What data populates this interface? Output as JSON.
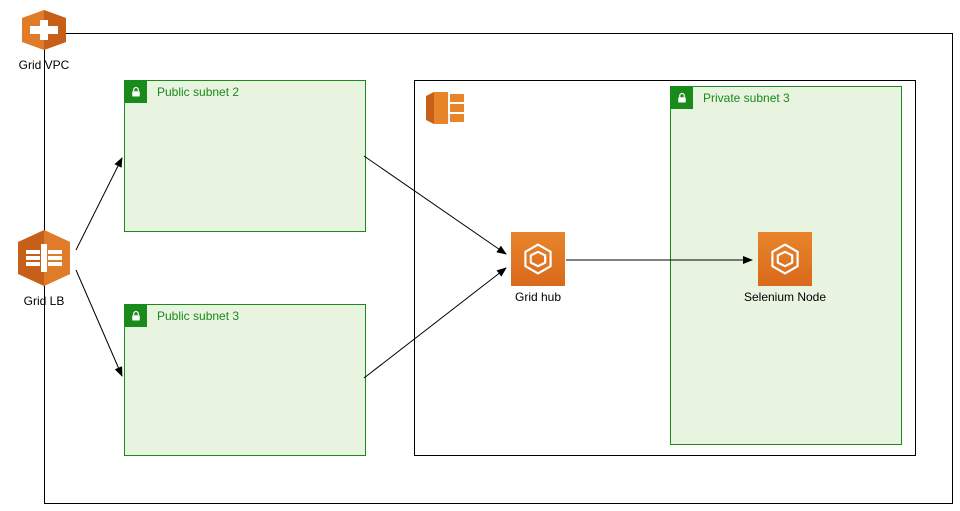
{
  "vpc": {
    "label": "Grid VPC"
  },
  "lb": {
    "label": "Grid LB"
  },
  "subnets": {
    "public2": {
      "label": "Public subnet 2"
    },
    "public3": {
      "label": "Public subnet 3"
    },
    "private3": {
      "label": "Private subnet 3"
    }
  },
  "nodes": {
    "grid_hub": {
      "label": "Grid hub"
    },
    "selenium_node": {
      "label": "Selenium Node"
    }
  },
  "icons": {
    "vpc_icon": "vpc-icon",
    "lb_icon": "load-balancer-icon",
    "ecs_icon": "ecs-cluster-icon",
    "ecs_service_icon": "ecs-service-icon",
    "lock_icon": "lock-icon"
  },
  "chart_data": {
    "type": "diagram",
    "title": "",
    "nodes": [
      {
        "id": "grid_vpc",
        "label": "Grid VPC",
        "type": "vpc-container"
      },
      {
        "id": "grid_lb",
        "label": "Grid LB",
        "type": "load-balancer"
      },
      {
        "id": "pub2",
        "label": "Public subnet 2",
        "type": "public-subnet",
        "parent": "grid_vpc"
      },
      {
        "id": "pub3",
        "label": "Public subnet 3",
        "type": "public-subnet",
        "parent": "grid_vpc"
      },
      {
        "id": "cluster",
        "label": "",
        "type": "ecs-cluster",
        "parent": "grid_vpc"
      },
      {
        "id": "priv3",
        "label": "Private subnet 3",
        "type": "private-subnet",
        "parent": "cluster"
      },
      {
        "id": "grid_hub",
        "label": "Grid hub",
        "type": "ecs-service",
        "parent": "cluster"
      },
      {
        "id": "sel_node",
        "label": "Selenium Node",
        "type": "ecs-service",
        "parent": "priv3"
      }
    ],
    "edges": [
      {
        "from": "grid_lb",
        "to": "pub2"
      },
      {
        "from": "grid_lb",
        "to": "pub3"
      },
      {
        "from": "pub2",
        "to": "grid_hub"
      },
      {
        "from": "pub3",
        "to": "grid_hub"
      },
      {
        "from": "grid_hub",
        "to": "sel_node"
      }
    ]
  }
}
